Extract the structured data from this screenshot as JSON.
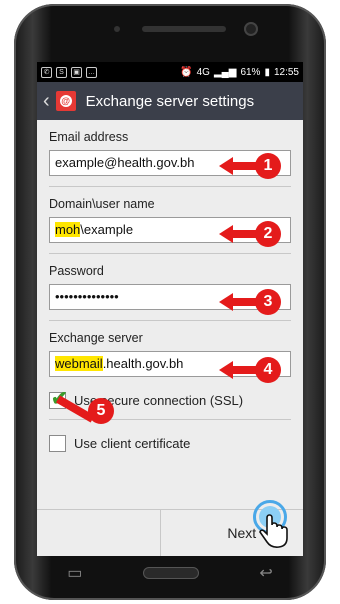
{
  "statusbar": {
    "left_icons": [
      "whatsapp-icon",
      "skype-icon",
      "image-icon",
      "chat-icon"
    ],
    "network": "4G",
    "battery": "61%",
    "time": "12:55"
  },
  "actionbar": {
    "title": "Exchange server settings"
  },
  "form": {
    "email_label": "Email address",
    "email_value": "example@health.gov.bh",
    "domain_label": "Domain\\user name",
    "domain_value_highlight": "moh",
    "domain_value_rest": "\\example",
    "password_label": "Password",
    "password_value": "••••••••••••••",
    "server_label": "Exchange server",
    "server_value_highlight": "webmail",
    "server_value_rest": ".health.gov.bh",
    "ssl_label": "Use secure connection (SSL)",
    "ssl_checked": true,
    "client_cert_label": "Use client certificate",
    "client_cert_checked": false
  },
  "footer": {
    "next_label": "Next"
  },
  "annotations": {
    "n1": "1",
    "n2": "2",
    "n3": "3",
    "n4": "4",
    "n5": "5",
    "color": "#e41b1b"
  }
}
